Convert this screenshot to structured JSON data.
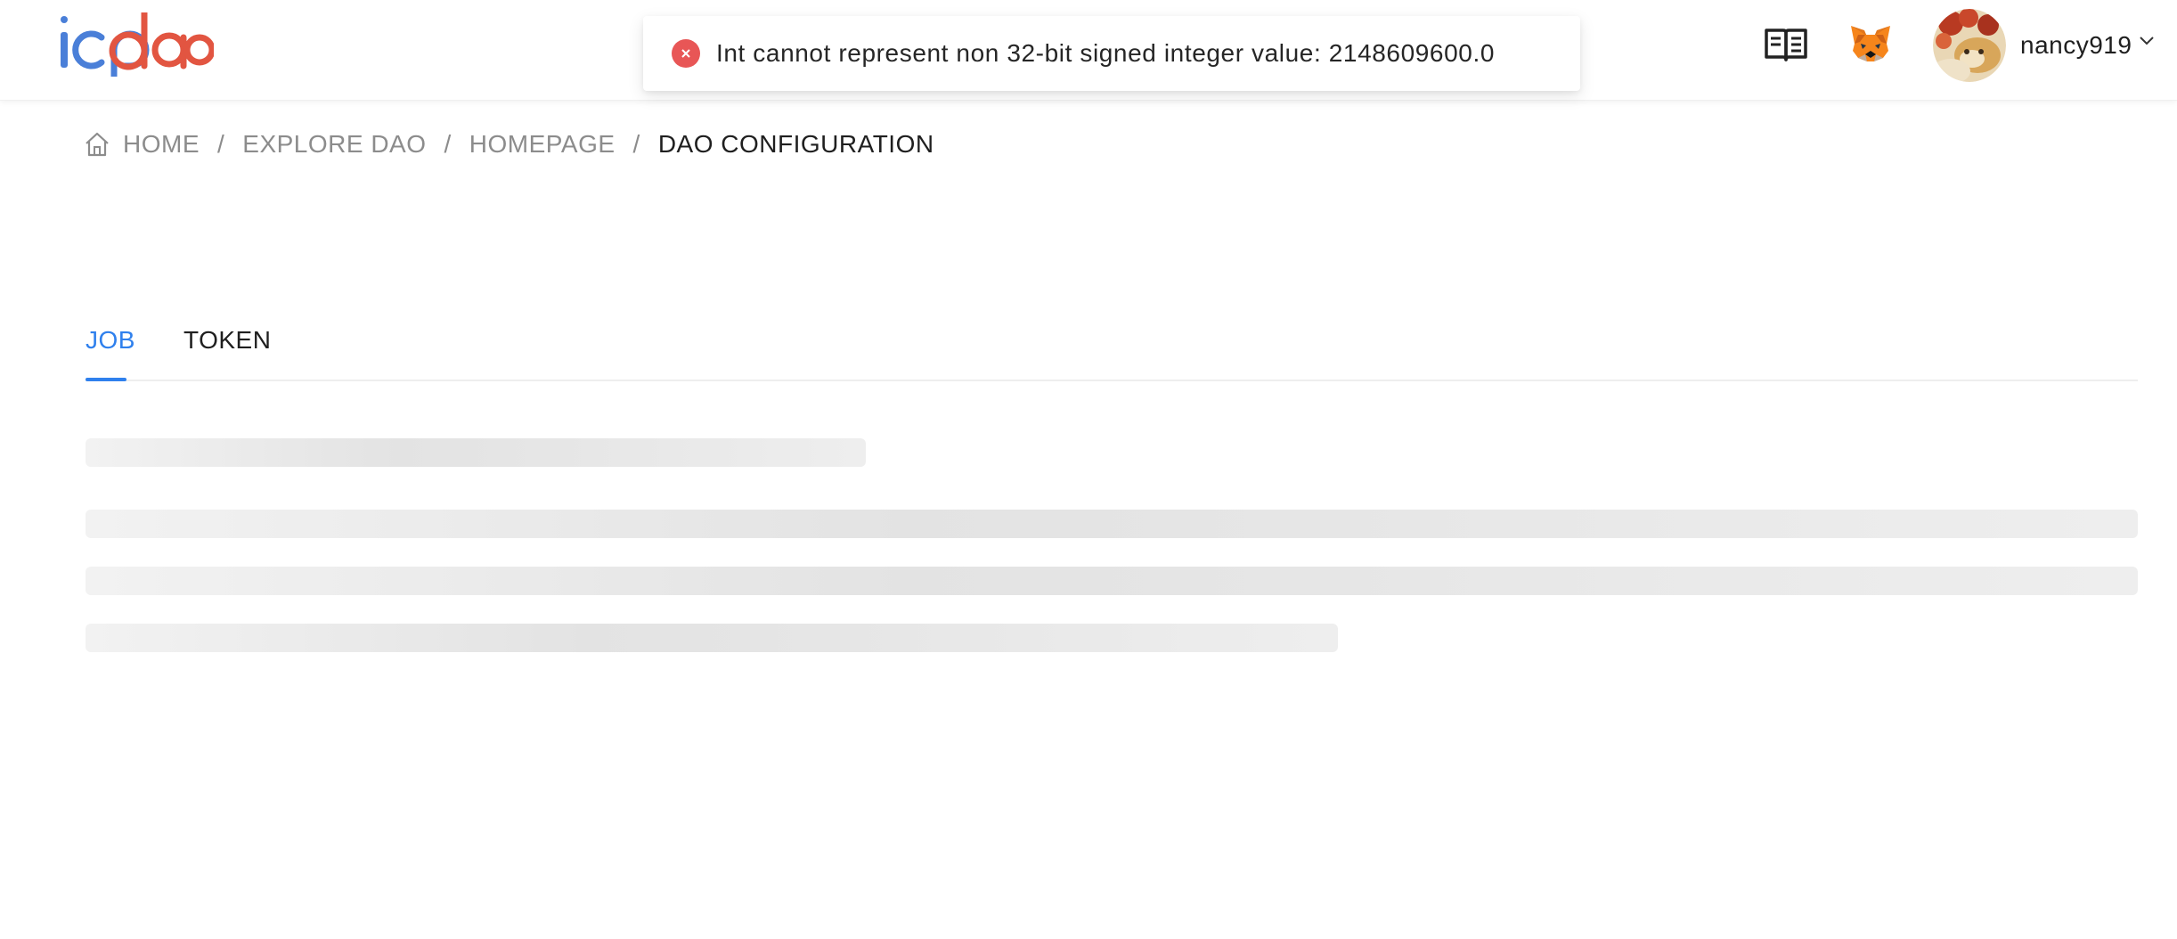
{
  "header": {
    "logo_text": "icpdao",
    "book_icon": "book-open-icon",
    "wallet_icon": "metamask-fox-icon",
    "user": {
      "name": "nancy919",
      "menu_icon": "chevron-down-icon"
    }
  },
  "toast": {
    "type": "error",
    "icon": "close-circle-icon",
    "message": "Int cannot represent non 32-bit signed integer value: 2148609600.0",
    "color": "#e85656"
  },
  "breadcrumb": {
    "icon": "home-icon",
    "items": [
      "HOME",
      "EXPLORE DAO",
      "HOMEPAGE",
      "DAO CONFIGURATION"
    ],
    "separator": "/"
  },
  "tabs": [
    {
      "label": "JOB",
      "active": true
    },
    {
      "label": "TOKEN",
      "active": false
    }
  ],
  "colors": {
    "accent": "#2f80ed",
    "logo_blue": "#4a7fd8",
    "logo_red": "#e25541",
    "error": "#e85656"
  }
}
